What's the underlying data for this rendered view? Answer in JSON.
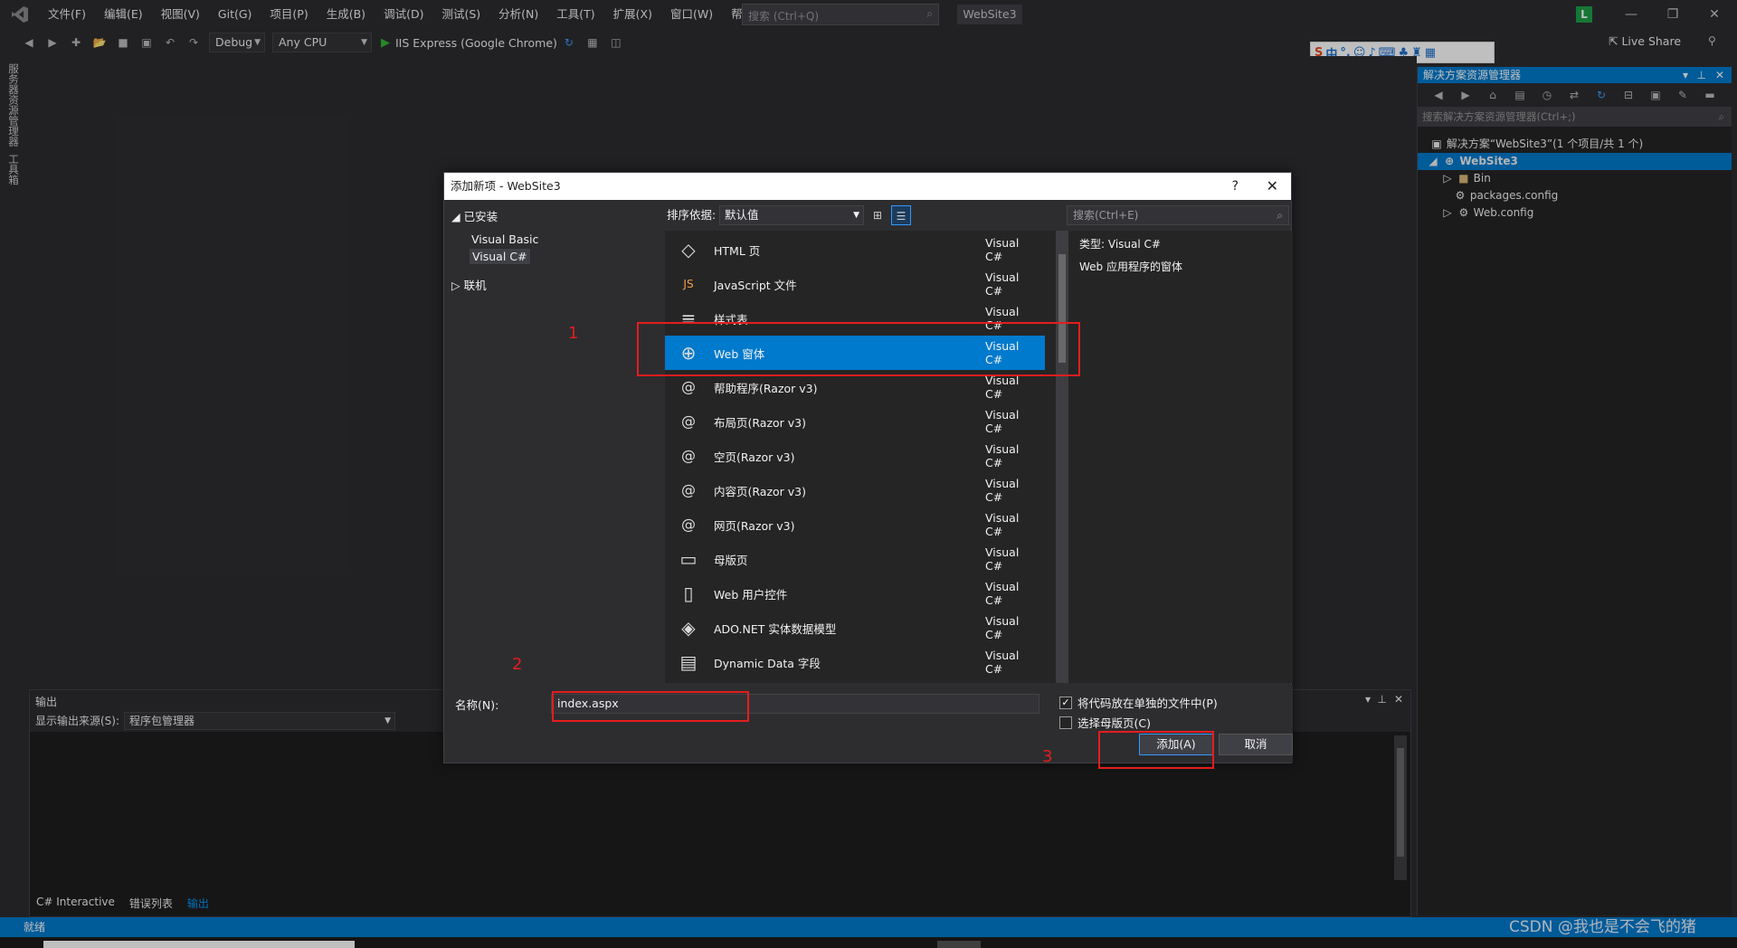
{
  "menu": [
    "文件(F)",
    "编辑(E)",
    "视图(V)",
    "Git(G)",
    "项目(P)",
    "生成(B)",
    "调试(D)",
    "测试(S)",
    "分析(N)",
    "工具(T)",
    "扩展(X)",
    "窗口(W)",
    "帮助(H)"
  ],
  "search": {
    "placeholder": "搜索 (Ctrl+Q)"
  },
  "project_name": "WebSite3",
  "user_initial": "L",
  "toolbar": {
    "config": "Debug",
    "platform": "Any CPU",
    "run_target": "IIS Express (Google Chrome)",
    "live_share": "Live Share"
  },
  "left_rail": [
    "服务器资源管理器",
    "工具箱"
  ],
  "solution_explorer": {
    "title": "解决方案资源管理器",
    "search_placeholder": "搜索解决方案资源管理器(Ctrl+;)",
    "tree": [
      {
        "label": "解决方案“WebSite3”(1 个项目/共 1 个)",
        "level": 0
      },
      {
        "label": "WebSite3",
        "level": 1
      },
      {
        "label": "Bin",
        "level": 2
      },
      {
        "label": "packages.config",
        "level": 2
      },
      {
        "label": "Web.config",
        "level": 2
      }
    ]
  },
  "output": {
    "title": "输出",
    "source_label": "显示输出来源(S):",
    "source_value": "程序包管理器",
    "tabs": [
      "C# Interactive",
      "错误列表",
      "输出"
    ]
  },
  "statusbar": {
    "text": "就绪",
    "watermark": "CSDN @我也是不会飞的猪"
  },
  "dialog": {
    "title": "添加新项 - WebSite3",
    "help": "?",
    "installed": "已安装",
    "languages": [
      "Visual Basic",
      "Visual C#"
    ],
    "online": "联机",
    "sort_label": "排序依据:",
    "sort_value": "默认值",
    "search_placeholder": "搜索(Ctrl+E)",
    "items": [
      {
        "name": "HTML 页",
        "type": "Visual C#",
        "icon": "html-page-icon",
        "glyph": "◇"
      },
      {
        "name": "JavaScript 文件",
        "type": "Visual C#",
        "icon": "javascript-file-icon",
        "glyph": "JS"
      },
      {
        "name": "样式表",
        "type": "Visual C#",
        "icon": "stylesheet-icon",
        "glyph": "≡"
      },
      {
        "name": "Web 窗体",
        "type": "Visual C#",
        "icon": "globe-icon",
        "glyph": "⊕"
      },
      {
        "name": "帮助程序(Razor v3)",
        "type": "Visual C#",
        "icon": "razor-helper-icon",
        "glyph": "@"
      },
      {
        "name": "布局页(Razor v3)",
        "type": "Visual C#",
        "icon": "razor-layout-icon",
        "glyph": "@"
      },
      {
        "name": "空页(Razor v3)",
        "type": "Visual C#",
        "icon": "razor-empty-icon",
        "glyph": "@"
      },
      {
        "name": "内容页(Razor v3)",
        "type": "Visual C#",
        "icon": "razor-content-icon",
        "glyph": "@"
      },
      {
        "name": "网页(Razor v3)",
        "type": "Visual C#",
        "icon": "razor-webpage-icon",
        "glyph": "@"
      },
      {
        "name": "母版页",
        "type": "Visual C#",
        "icon": "master-page-icon",
        "glyph": "▭"
      },
      {
        "name": "Web 用户控件",
        "type": "Visual C#",
        "icon": "user-control-icon",
        "glyph": "▯"
      },
      {
        "name": "ADO.NET 实体数据模型",
        "type": "Visual C#",
        "icon": "entity-model-icon",
        "glyph": "◈"
      },
      {
        "name": "Dynamic Data 字段",
        "type": "Visual C#",
        "icon": "dynamic-data-icon",
        "glyph": "▤"
      }
    ],
    "detail": {
      "type_label": "类型:",
      "type_value": "Visual C#",
      "description": "Web 应用程序的窗体"
    },
    "name_label": "名称(N):",
    "name_value": "index.aspx",
    "check_separate": "将代码放在单独的文件中(P)",
    "check_master": "选择母版页(C)",
    "add": "添加(A)",
    "cancel": "取消"
  },
  "annotations": [
    "1",
    "2",
    "3"
  ],
  "colors": {
    "accent": "#007acc",
    "annotation_red": "#e51d1d"
  }
}
